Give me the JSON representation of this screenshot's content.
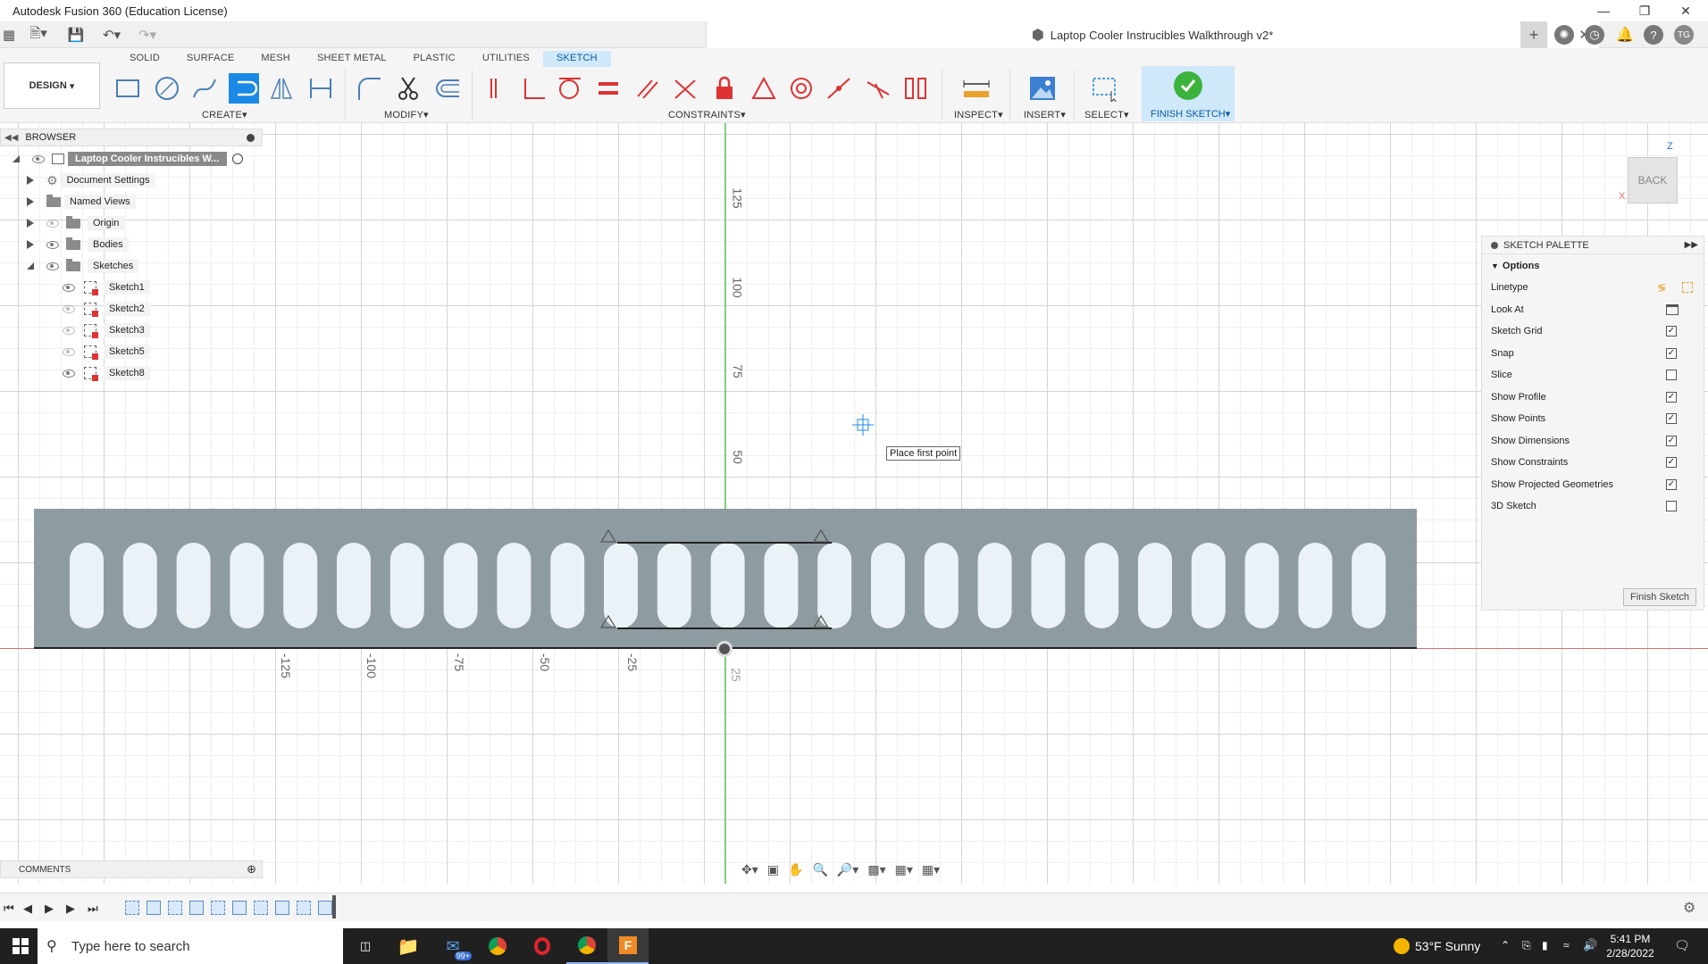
{
  "titlebar": {
    "title": "Autodesk Fusion 360 (Education License)"
  },
  "document": {
    "tab_title": "Laptop Cooler Instrucibles Walkthrough v2*"
  },
  "user": {
    "initials": "TG"
  },
  "ribbon": {
    "workspace": "DESIGN",
    "tabs": [
      "SOLID",
      "SURFACE",
      "MESH",
      "SHEET METAL",
      "PLASTIC",
      "UTILITIES",
      "SKETCH"
    ],
    "active_tab": "SKETCH",
    "groups": {
      "create": "CREATE",
      "modify": "MODIFY",
      "constraints": "CONSTRAINTS",
      "inspect": "INSPECT",
      "insert": "INSERT",
      "select": "SELECT",
      "finish": "FINISH SKETCH"
    }
  },
  "browser": {
    "header": "BROWSER",
    "root": "Laptop Cooler Instrucibles W...",
    "items": [
      "Document Settings",
      "Named Views",
      "Origin",
      "Bodies",
      "Sketches"
    ],
    "sketches": [
      "Sketch1",
      "Sketch2",
      "Sketch3",
      "Sketch5",
      "Sketch8"
    ]
  },
  "canvas": {
    "tooltip": "Place first point",
    "y_ticks": [
      "125",
      "100",
      "75",
      "50",
      "25"
    ],
    "x_ticks": [
      "-125",
      "-100",
      "-75",
      "-50",
      "-25"
    ],
    "slot_count": 25
  },
  "viewcube": {
    "face": "BACK",
    "axis_z": "Z",
    "axis_x": "X"
  },
  "palette": {
    "header": "SKETCH PALETTE",
    "section": "Options",
    "rows": [
      {
        "label": "Linetype",
        "kind": "icons"
      },
      {
        "label": "Look At",
        "kind": "icon"
      },
      {
        "label": "Sketch Grid",
        "checked": true
      },
      {
        "label": "Snap",
        "checked": true
      },
      {
        "label": "Slice",
        "checked": false
      },
      {
        "label": "Show Profile",
        "checked": true
      },
      {
        "label": "Show Points",
        "checked": true
      },
      {
        "label": "Show Dimensions",
        "checked": true
      },
      {
        "label": "Show Constraints",
        "checked": true
      },
      {
        "label": "Show Projected Geometries",
        "checked": true
      },
      {
        "label": "3D Sketch",
        "checked": false
      }
    ],
    "finish_button": "Finish Sketch"
  },
  "comments": {
    "label": "COMMENTS"
  },
  "taskbar": {
    "search_placeholder": "Type here to search",
    "mail_badge": "99+",
    "weather": "53°F  Sunny",
    "time": "5:41 PM",
    "date": "2/28/2022"
  },
  "colors": {
    "accent": "#1a8ae6",
    "plate": "#8e9ba0",
    "slot": "#eaf1f7",
    "finish_green": "#3cb33c"
  }
}
